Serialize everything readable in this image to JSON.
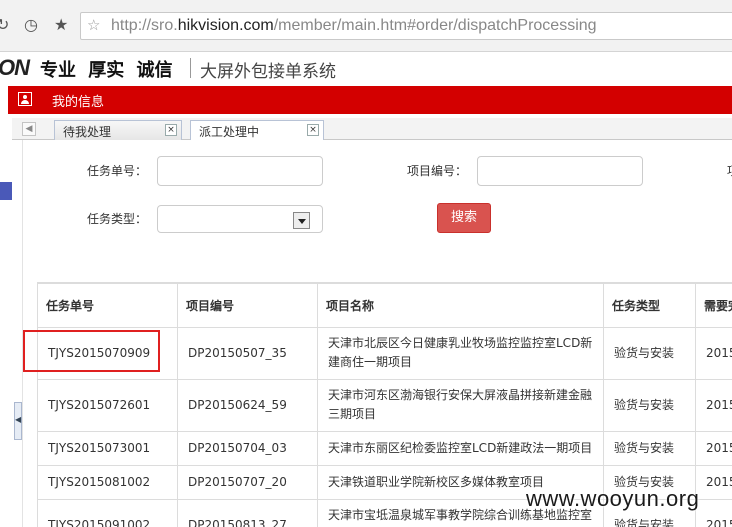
{
  "browser": {
    "url_prefix": "http://sro.",
    "url_domain": "hikvision.com",
    "url_suffix": "/member/main.htm#order/dispatchProcessing",
    "back_glyph": "↻",
    "history_glyph": "◷",
    "star_glyph": "★",
    "outline_star_glyph": "☆"
  },
  "header": {
    "logo_fragment": "ON",
    "motto": "专业 厚实 诚信",
    "system_name": "大屏外包接单系统"
  },
  "redbar": {
    "title": "我的信息"
  },
  "tabs": [
    {
      "label": "待我处理",
      "close": "×"
    },
    {
      "label": "派工处理中",
      "close": "×"
    }
  ],
  "filters": {
    "task_no_label": "任务单号：",
    "project_no_label": "项目编号：",
    "cut_label": "项",
    "task_type_label": "任务类型：",
    "search_button": "搜索"
  },
  "table": {
    "headers": [
      "任务单号",
      "项目编号",
      "项目名称",
      "任务类型",
      "需要完"
    ],
    "rows": [
      {
        "task_no": "TJYS2015070909",
        "project_no": "DP20150507_35",
        "project_name": "天津市北辰区今日健康乳业牧场监控监控室LCD新建商住一期项目",
        "task_type": "验货与安装",
        "date": "2015"
      },
      {
        "task_no": "TJYS2015072601",
        "project_no": "DP20150624_59",
        "project_name": "天津市河东区渤海银行安保大屏液晶拼接新建金融三期项目",
        "task_type": "验货与安装",
        "date": "2015"
      },
      {
        "task_no": "TJYS2015073001",
        "project_no": "DP20150704_03",
        "project_name": "天津市东丽区纪检委监控室LCD新建政法一期项目",
        "task_type": "验货与安装",
        "date": "2015"
      },
      {
        "task_no": "TJYS2015081002",
        "project_no": "DP20150707_20",
        "project_name": "天津铁道职业学院新校区多媒体教室项目",
        "task_type": "验货与安装",
        "date": "2015"
      },
      {
        "task_no": "TJYS2015091002",
        "project_no": "DP20150813_27",
        "project_name": "天津市宝坻温泉城军事教学院综合训练基地监控室L",
        "task_type": "验货与安装",
        "date": "2015"
      }
    ]
  },
  "watermark": "www.wooyun.org",
  "colors": {
    "accent_red": "#d30000",
    "search_button": "#d9534f",
    "highlight": "#e02020"
  }
}
